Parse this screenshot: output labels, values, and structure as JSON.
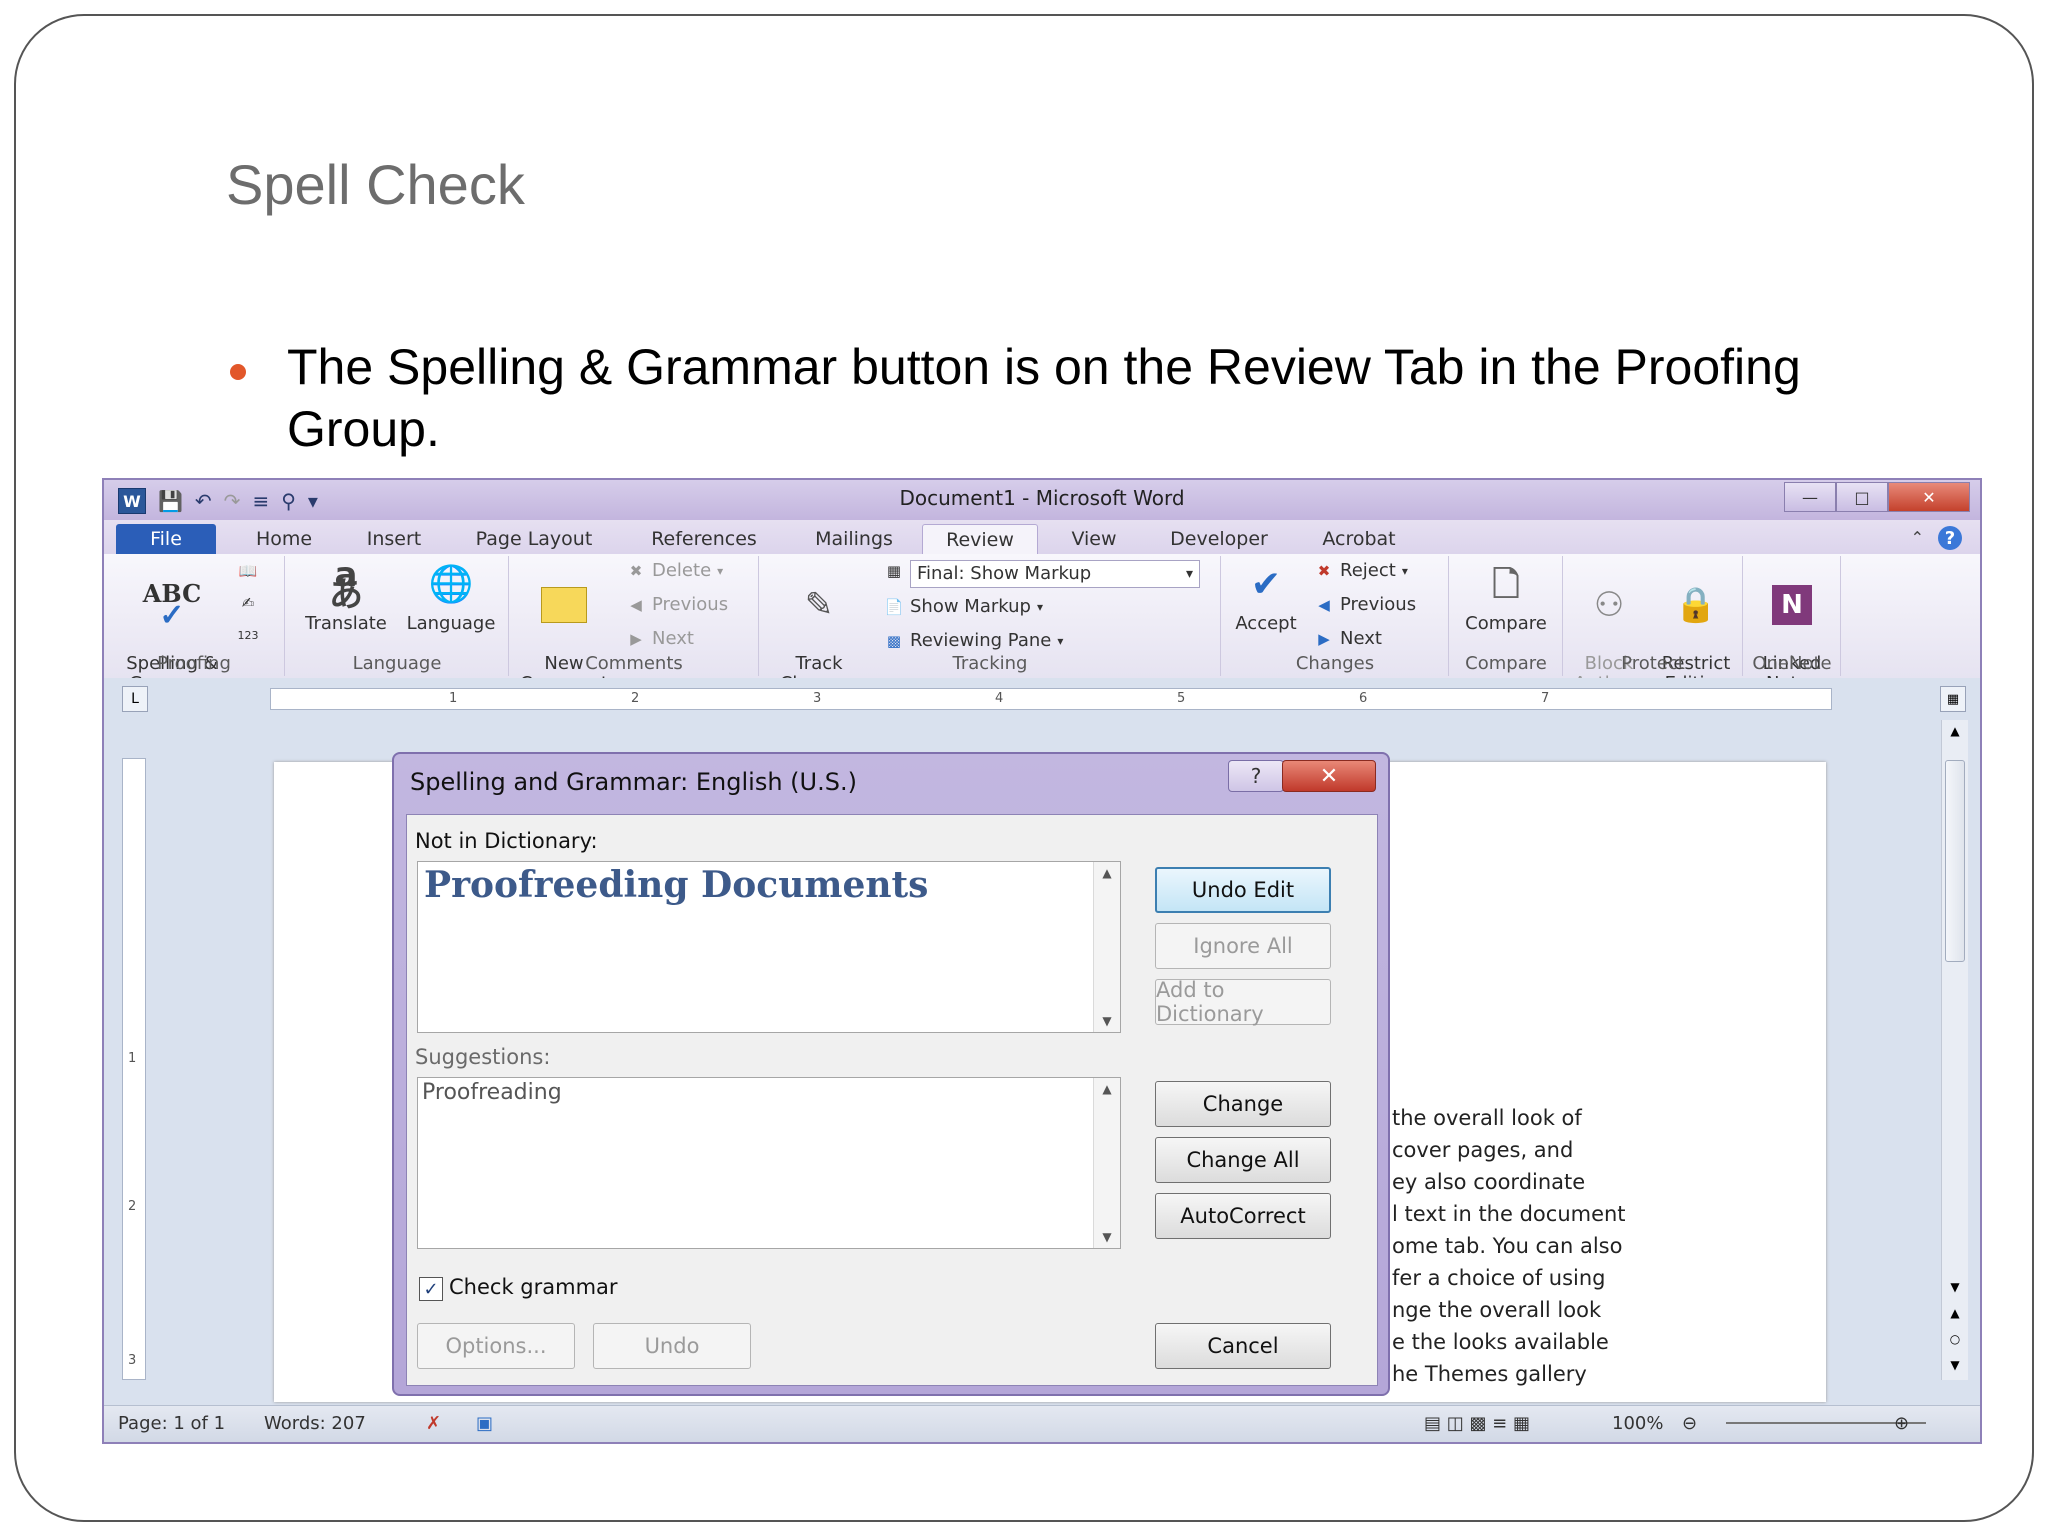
{
  "slide": {
    "title": "Spell Check",
    "bullet": "The Spelling & Grammar button is on the Review Tab in the Proofing Group."
  },
  "window": {
    "title": "Document1  -  Microsoft Word",
    "qat_icons": [
      "word-logo",
      "save-icon",
      "undo-icon",
      "redo-icon",
      "format-icon",
      "find-icon",
      "customize-icon"
    ]
  },
  "tabs": [
    "File",
    "Home",
    "Insert",
    "Page Layout",
    "References",
    "Mailings",
    "Review",
    "View",
    "Developer",
    "Acrobat"
  ],
  "ribbon": {
    "proofing": {
      "label": "Proofing",
      "spelling": "Spelling &\nGrammar",
      "spelling_icon_text": "ABC"
    },
    "language": {
      "label": "Language",
      "translate": "Translate",
      "language": "Language"
    },
    "comments": {
      "label": "Comments",
      "new_comment": "New\nComment",
      "delete": "Delete",
      "previous": "Previous",
      "next": "Next"
    },
    "tracking": {
      "label": "Tracking",
      "track_changes": "Track\nChanges",
      "final_markup": "Final: Show Markup",
      "show_markup": "Show Markup",
      "reviewing_pane": "Reviewing Pane"
    },
    "changes": {
      "label": "Changes",
      "accept": "Accept",
      "reject": "Reject",
      "previous": "Previous",
      "next": "Next"
    },
    "compare": {
      "label": "Compare",
      "compare": "Compare"
    },
    "protect": {
      "label": "Protect",
      "block_authors": "Block\nAuthors",
      "restrict_editing": "Restrict\nEditing"
    },
    "onenote": {
      "label": "OneNote",
      "linked_notes": "Linked\nNotes"
    }
  },
  "ruler": {
    "ticks": [
      "1",
      "2",
      "3",
      "4",
      "5",
      "6",
      "7"
    ]
  },
  "vruler": {
    "ticks": [
      "1",
      "2",
      "3"
    ]
  },
  "document": {
    "lines": [
      "the overall look of",
      "cover pages, and",
      "ey also coordinate",
      "l text in the document",
      "ome tab. You can also",
      "fer a choice of using",
      "nge the overall look",
      "e the looks available",
      "he Themes gallery"
    ]
  },
  "status": {
    "page": "Page: 1 of 1",
    "words": "Words: 207",
    "zoom": "100%"
  },
  "dialog": {
    "title": "Spelling and Grammar: English (U.S.)",
    "not_in_dict_label": "Not in Dictionary:",
    "not_in_dict_text": "Proofreeding Documents",
    "suggestions_label": "Suggestions:",
    "suggestions": [
      "Proofreading"
    ],
    "buttons": {
      "undo_edit": "Undo Edit",
      "ignore_all": "Ignore All",
      "add_to_dictionary": "Add to Dictionary",
      "change": "Change",
      "change_all": "Change All",
      "autocorrect": "AutoCorrect",
      "options": "Options...",
      "undo": "Undo",
      "cancel": "Cancel"
    },
    "check_grammar_label": "Check grammar",
    "check_grammar": true
  },
  "colors": {
    "bullet": "#e2572a",
    "file_tab": "#2b5eb8",
    "close": "#c0392b"
  }
}
